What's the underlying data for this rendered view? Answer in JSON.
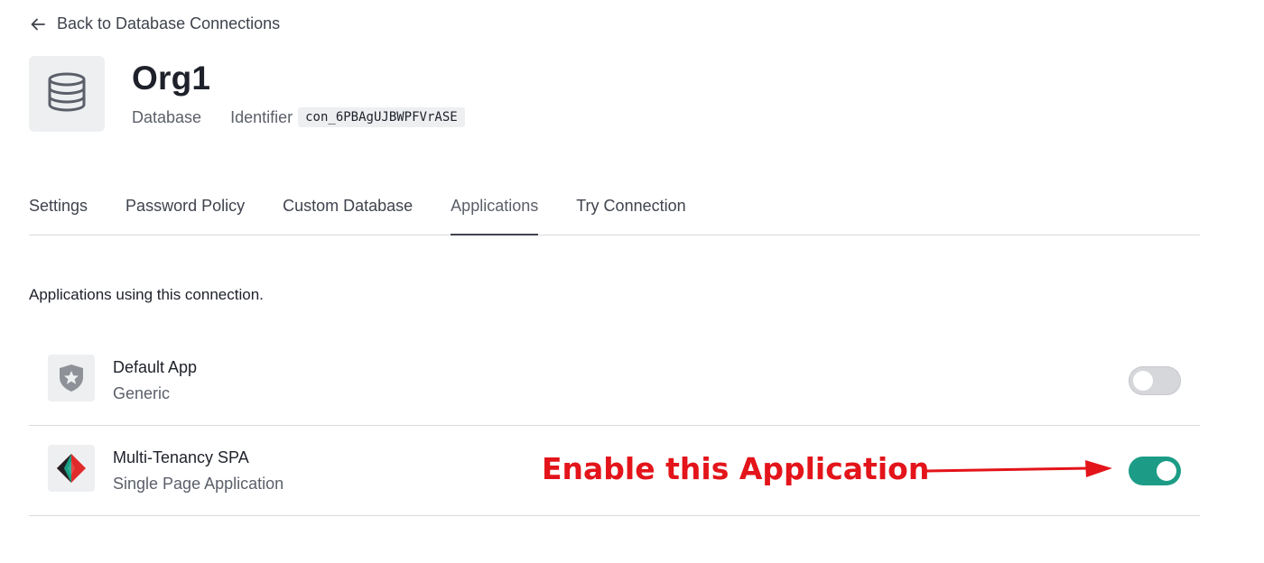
{
  "nav": {
    "back_label": "Back to Database Connections"
  },
  "header": {
    "title": "Org1",
    "type": "Database",
    "identifier_label": "Identifier",
    "identifier_value": "con_6PBAgUJBWPFVrASE",
    "icon": "database-icon"
  },
  "tabs": [
    {
      "label": "Settings",
      "active": false
    },
    {
      "label": "Password Policy",
      "active": false
    },
    {
      "label": "Custom Database",
      "active": false
    },
    {
      "label": "Applications",
      "active": true
    },
    {
      "label": "Try Connection",
      "active": false
    }
  ],
  "applications": {
    "description": "Applications using this connection.",
    "items": [
      {
        "name": "Default App",
        "type": "Generic",
        "icon": "auth0-shield-icon",
        "enabled": false
      },
      {
        "name": "Multi-Tenancy SPA",
        "type": "Single Page Application",
        "icon": "spa-diamond-icon",
        "enabled": true
      }
    ]
  },
  "annotation": {
    "text": "Enable this Application",
    "color": "#e3141a"
  },
  "colors": {
    "toggle_on": "#1c9c86",
    "toggle_off": "#d5d7da",
    "border": "#d8dadd"
  }
}
